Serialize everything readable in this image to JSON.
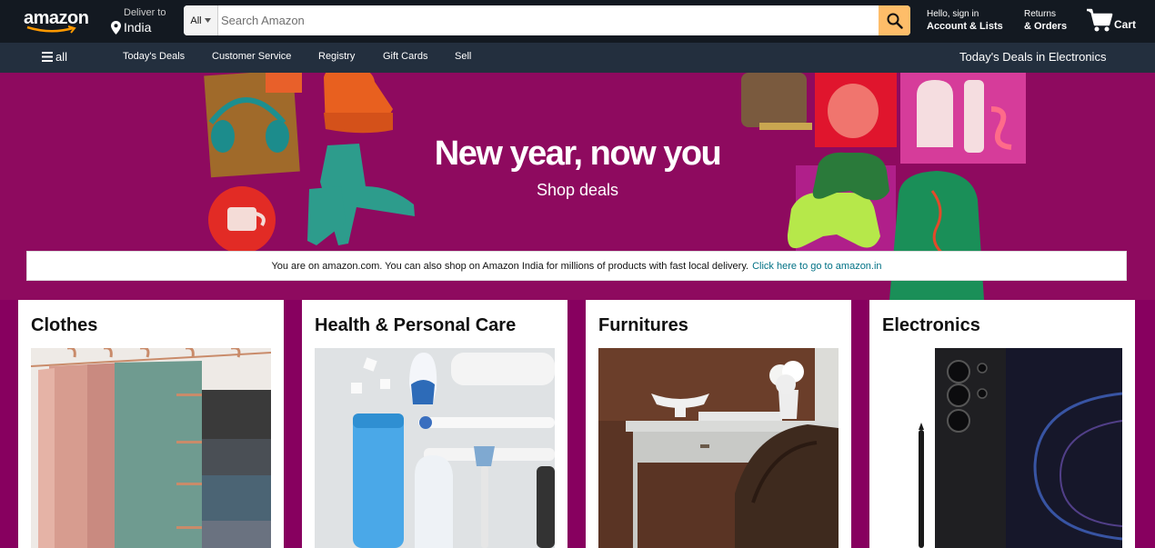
{
  "header": {
    "logo_text": "amazon",
    "deliver_line1": "Deliver to",
    "deliver_line2": "India",
    "search_category": "All",
    "search_placeholder": "Search Amazon",
    "account_line1": "Hello, sign in",
    "account_line2": "Account & Lists",
    "orders_line1": "Returns",
    "orders_line2": "& Orders",
    "cart_label": "Cart"
  },
  "subnav": {
    "menu_label": "all",
    "items": [
      "Today's Deals",
      "Customer Service",
      "Registry",
      "Gift Cards",
      "Sell"
    ],
    "promo": "Today's Deals in Electronics"
  },
  "hero": {
    "title": "New year, now you",
    "subtitle": "Shop deals"
  },
  "notice": {
    "text": "You are on amazon.com. You can also shop on Amazon India for millions of products with fast local delivery.",
    "link": "Click here to go to amazon.in"
  },
  "cards": [
    {
      "title": "Clothes"
    },
    {
      "title": "Health & Personal Care"
    },
    {
      "title": "Furnitures"
    },
    {
      "title": "Electronics"
    }
  ],
  "colors": {
    "topnav": "#131921",
    "subnav": "#232f3e",
    "background": "#87005f",
    "search_button": "#febd69",
    "link": "#007185"
  }
}
